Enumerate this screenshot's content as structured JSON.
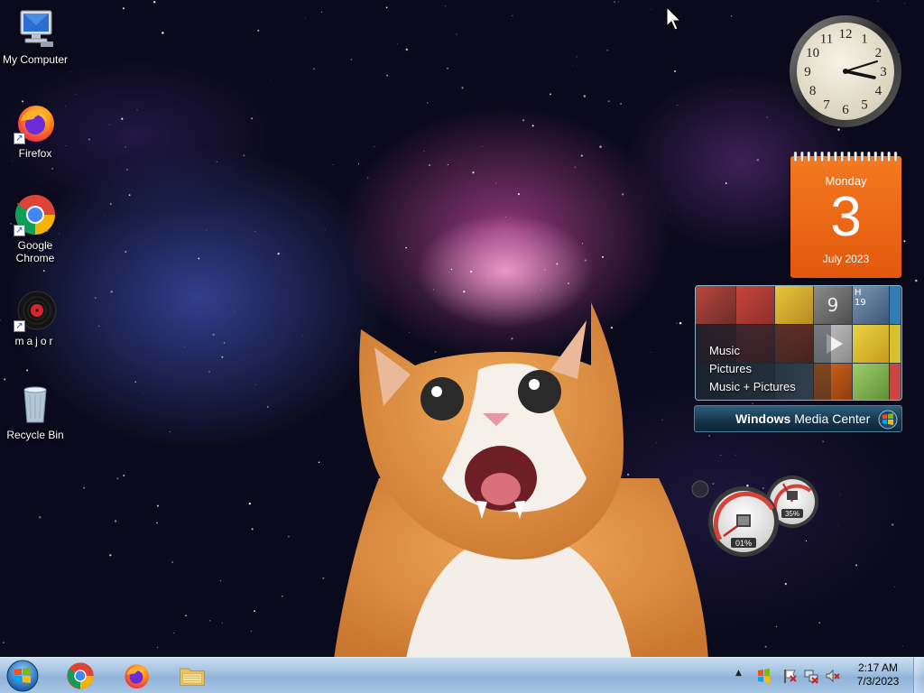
{
  "desktop": {
    "icons": [
      {
        "label": "My Computer"
      },
      {
        "label": "Firefox"
      },
      {
        "label": "Google Chrome"
      },
      {
        "label": "major"
      },
      {
        "label": "Recycle Bin"
      }
    ],
    "shortcut_glyph": "↗"
  },
  "gadgets": {
    "clock": {
      "numerals": [
        "12",
        "1",
        "2",
        "3",
        "4",
        "5",
        "6",
        "7",
        "8",
        "9",
        "10",
        "11"
      ]
    },
    "calendar": {
      "day_of_week": "Monday",
      "day": "3",
      "month_year": "July 2023"
    },
    "media_center": {
      "menu": [
        "Music",
        "Pictures",
        "Music + Pictures"
      ],
      "brand_bold": "Windows",
      "brand_rest": " Media Center",
      "tile_labels": {
        "number": "9",
        "letter": "H",
        "small": "19"
      }
    },
    "cpu_meter": {
      "cpu_percent": "01%",
      "memory_percent": "35%"
    }
  },
  "taskbar": {
    "apps": [
      "chrome",
      "firefox",
      "file-explorer"
    ],
    "tray": {
      "time": "2:17 AM",
      "date": "7/3/2023",
      "overflow": "▲"
    }
  },
  "colors": {
    "calendar_orange": "#ec6617",
    "taskbar_blue": "#9ebfdf",
    "wmc_teal": "#1f4a63"
  }
}
